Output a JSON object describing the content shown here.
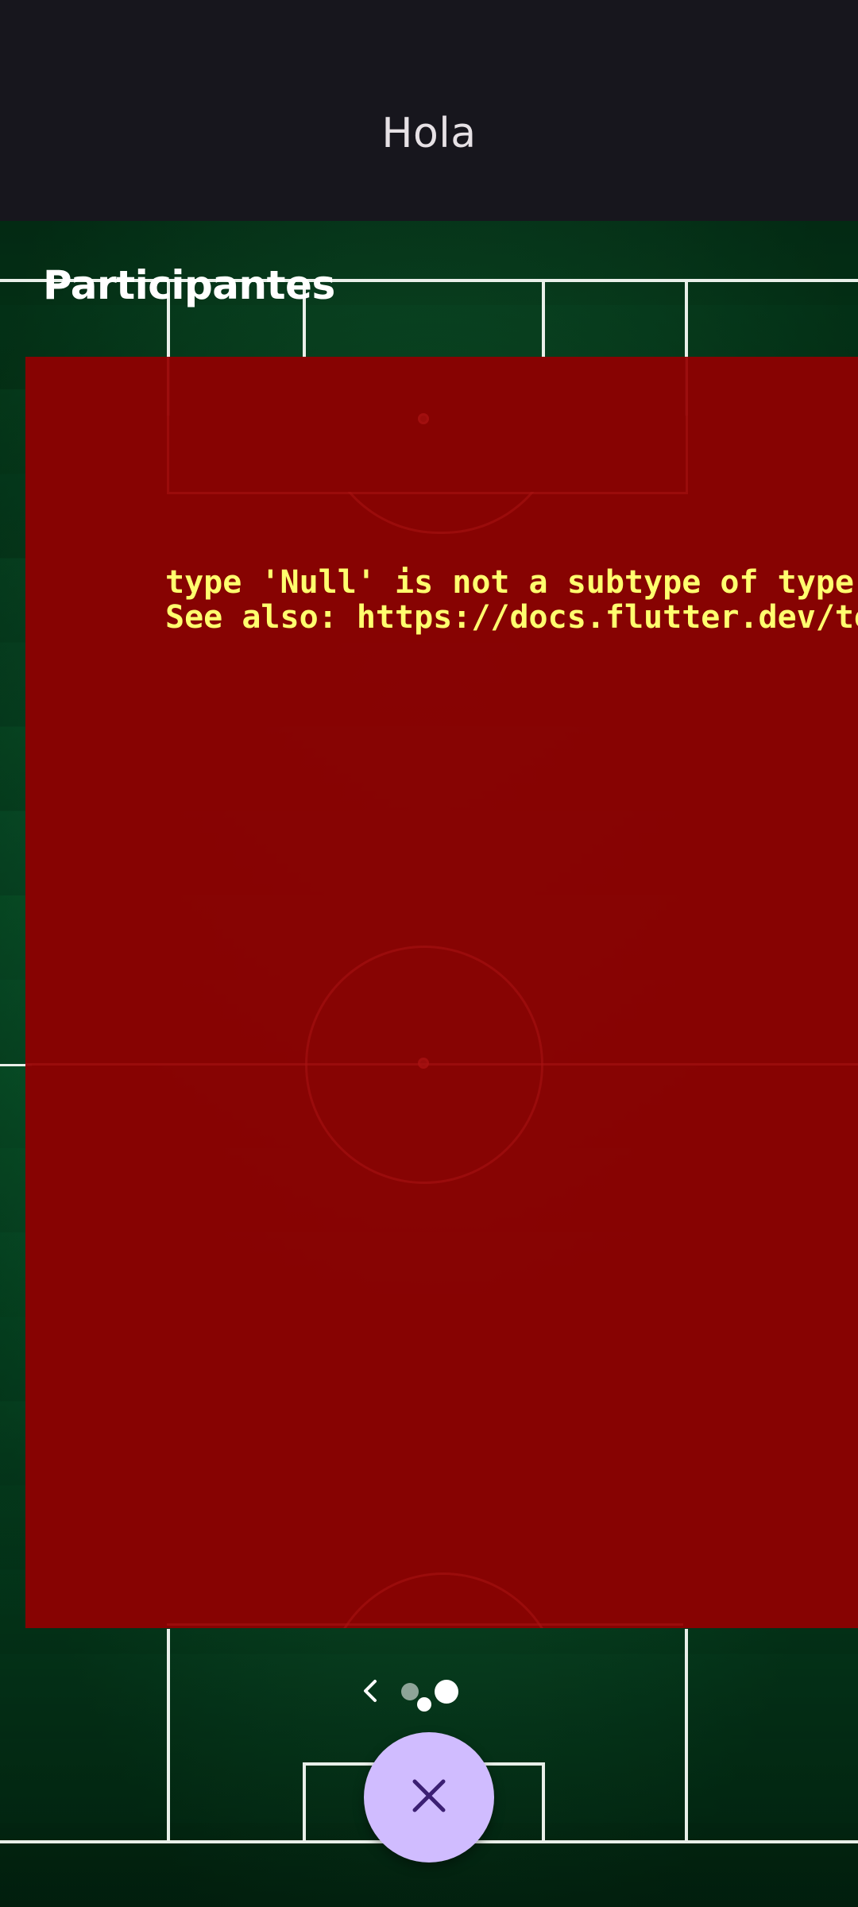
{
  "appbar": {
    "title": "Hola"
  },
  "section": {
    "header": "Participantes"
  },
  "error": {
    "line1": "type 'Null' is not a subtype of type '",
    "line2": "See also: https://docs.flutter.dev/tes"
  },
  "pager": {
    "back_icon": "chevron-left-icon",
    "page_count": 3,
    "current_page": 3
  },
  "fab": {
    "icon": "close-icon"
  },
  "colors": {
    "appbar_bg": "#17161d",
    "error_bg": "#8a0202",
    "error_text": "#ffff6e",
    "fab_bg": "#d0bcff",
    "fab_icon": "#3b1f73",
    "field_lines": "#e9efe9"
  }
}
